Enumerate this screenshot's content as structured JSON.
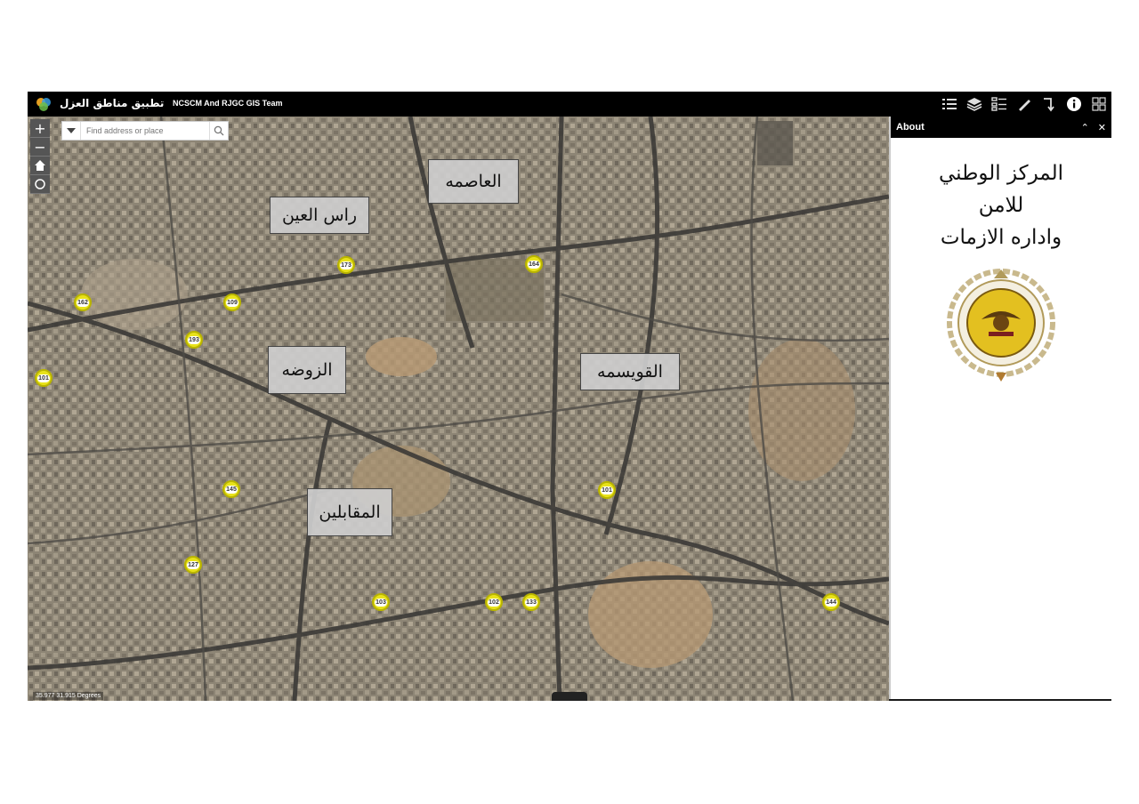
{
  "app": {
    "title": "تطبيق مناطق العزل",
    "subtitle": "NCSCM And RJGC GIS Team"
  },
  "toolbar": {
    "icons": [
      "list-icon",
      "layers-icon",
      "legend-icon",
      "measure-icon",
      "directions-icon",
      "info-icon",
      "basemap-icon"
    ]
  },
  "map": {
    "zoom_in": "+",
    "zoom_out": "−",
    "search_placeholder": "Find address or place",
    "coordinates": "35.977 31.915 Degrees",
    "districts": [
      {
        "id": "asimah",
        "label": "العاصمه"
      },
      {
        "id": "ras-alein",
        "label": "راس العين"
      },
      {
        "id": "rawda",
        "label": "الزوضه"
      },
      {
        "id": "quwaysimah",
        "label": "القويسمه"
      },
      {
        "id": "muqabalayn",
        "label": "المقابلين"
      }
    ],
    "markers": [
      "173",
      "164",
      "162",
      "109",
      "193",
      "101",
      "145",
      "101",
      "127",
      "103",
      "102",
      "133",
      "144"
    ]
  },
  "about": {
    "title": "About",
    "line1": "المركز الوطني",
    "line2": "للامن",
    "line3": "واداره الازمات"
  },
  "colors": {
    "header_bg": "#000000",
    "marker_fill": "#e8e21a",
    "label_bg": "#cdcdcd"
  }
}
